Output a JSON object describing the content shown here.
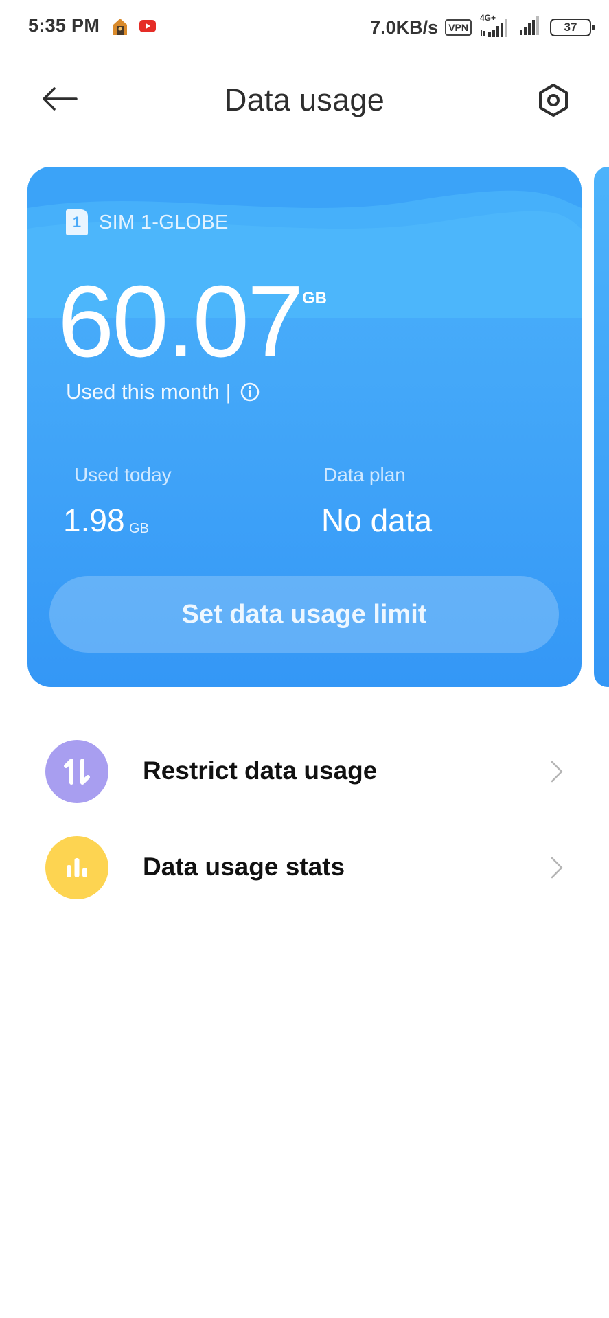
{
  "status_bar": {
    "time": "5:35 PM",
    "net_speed": "7.0KB/s",
    "vpn": "VPN",
    "network_type": "4G+",
    "battery": "37",
    "icons": [
      "notification-app-icon",
      "youtube-icon",
      "signal-icon",
      "signal-icon"
    ]
  },
  "header": {
    "title": "Data usage",
    "back_icon": "arrow-left-icon",
    "settings_icon": "settings-hexagon-icon"
  },
  "card": {
    "sim_number": "1",
    "sim_label": "SIM 1-GLOBE",
    "used_month_value": "60.07",
    "used_month_unit": "GB",
    "used_month_label": "Used this month |",
    "used_today_label": "Used today",
    "used_today_value": "1.98",
    "used_today_unit": "GB",
    "data_plan_label": "Data plan",
    "data_plan_value": "No data",
    "limit_button": "Set data usage limit",
    "color_top": "#4cb3fb",
    "color_bottom": "#3497f6"
  },
  "list": {
    "items": [
      {
        "label": "Restrict data usage",
        "icon": "up-down-arrows-icon",
        "color": "#a89ef0"
      },
      {
        "label": "Data usage stats",
        "icon": "bar-chart-icon",
        "color": "#fdd451"
      }
    ]
  }
}
